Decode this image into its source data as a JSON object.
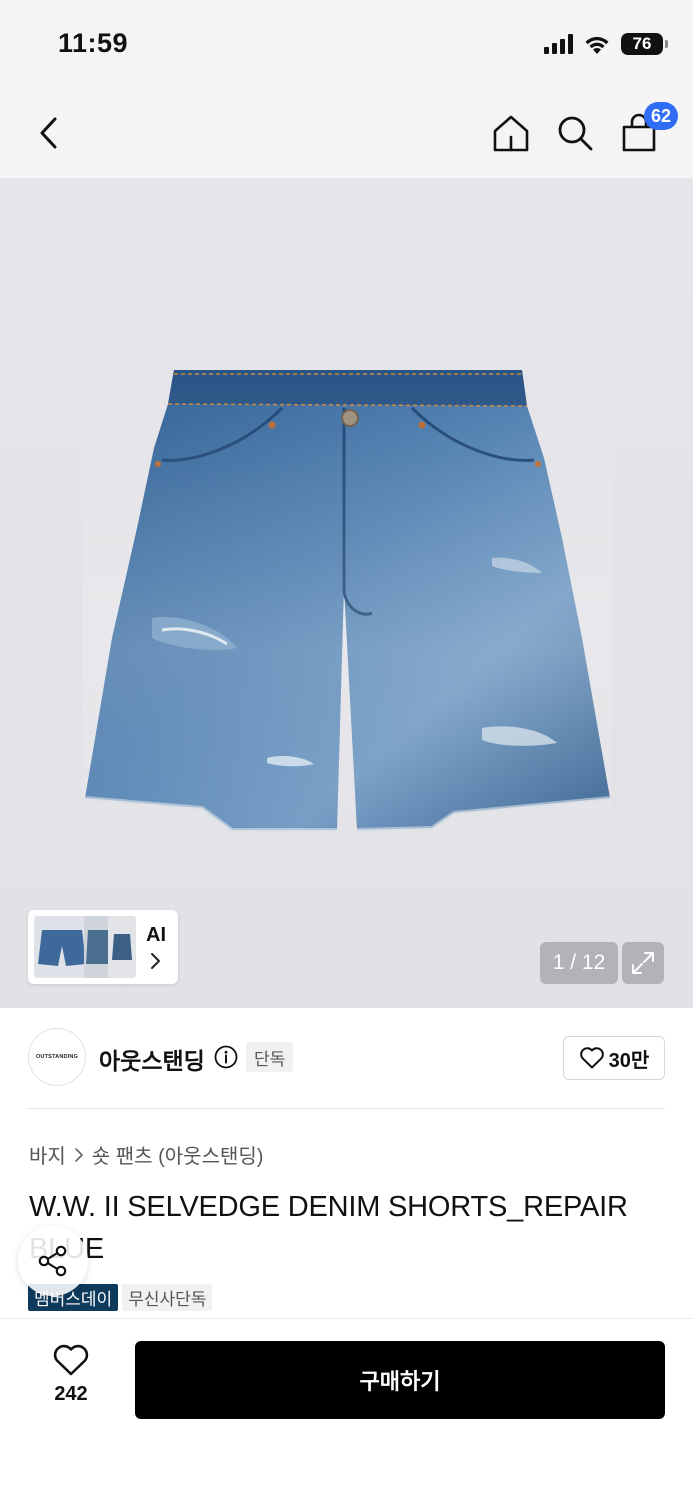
{
  "status_bar": {
    "time": "11:59",
    "battery": "76"
  },
  "nav": {
    "cart_count": "62"
  },
  "gallery": {
    "ai_label": "AI",
    "counter": "1 / 12"
  },
  "brand": {
    "logo_text": "OUTSTANDING",
    "name": "아웃스탠딩",
    "tag": "단독",
    "likes": "30만"
  },
  "product": {
    "breadcrumb": [
      "바지",
      "숏 팬츠 (아웃스탠딩)"
    ],
    "title": "W.W. II SELVEDGE DENIM SHORTS_REPAIR BLUE",
    "badges": [
      "멤버스데이",
      "무신사단독"
    ]
  },
  "bottom": {
    "wish_count": "242",
    "buy_label": "구매하기"
  },
  "colors": {
    "accent": "#2f6df6",
    "badge_dark": "#0e3a5c",
    "buy_button": "#000000"
  }
}
